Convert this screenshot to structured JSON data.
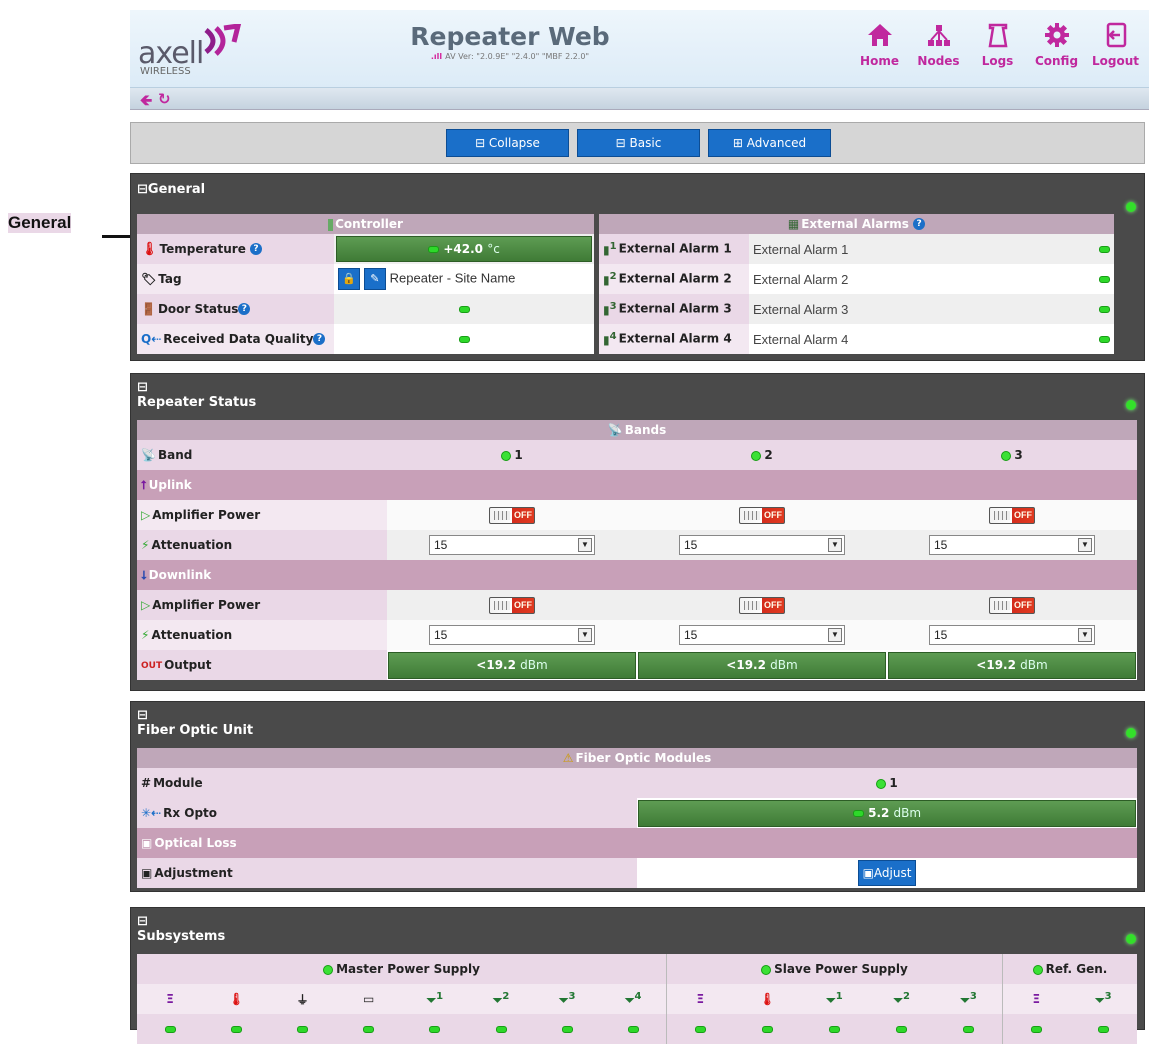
{
  "callout": {
    "label": "General"
  },
  "header": {
    "logo_text": "axell",
    "logo_sub": "WIRELESS",
    "title": "Repeater Web",
    "version": "AV Ver: \"2.0.9E\" \"2.4.0\" \"MBF 2.2.0\"",
    "nav": [
      {
        "label": "Home",
        "icon": "home-icon"
      },
      {
        "label": "Nodes",
        "icon": "nodes-icon"
      },
      {
        "label": "Logs",
        "icon": "logs-icon"
      },
      {
        "label": "Config",
        "icon": "gear-icon"
      },
      {
        "label": "Logout",
        "icon": "logout-icon"
      }
    ]
  },
  "toolbar": {
    "back_icon": "back-arrow-icon",
    "refresh_icon": "refresh-icon"
  },
  "buttons": {
    "collapse": "⊟ Collapse",
    "basic": "⊟ Basic",
    "advanced": "⊞ Advanced"
  },
  "general": {
    "title": "⊟General",
    "controller_header": "Controller",
    "rows": [
      {
        "label": "Temperature",
        "value": "+42.0",
        "unit": "°c"
      },
      {
        "label": "Tag",
        "value": "Repeater - Site Name"
      },
      {
        "label": "Door Status"
      },
      {
        "label": "Received Data Quality"
      }
    ],
    "alarms_header": "External Alarms",
    "alarms": [
      {
        "label": "External Alarm 1",
        "sup": "1",
        "value": "External Alarm 1"
      },
      {
        "label": "External Alarm 2",
        "sup": "2",
        "value": "External Alarm 2"
      },
      {
        "label": "External Alarm 3",
        "sup": "3",
        "value": "External Alarm 3"
      },
      {
        "label": "External Alarm 4",
        "sup": "4",
        "value": "External Alarm 4"
      }
    ]
  },
  "repeater": {
    "collapse_glyph": "⊟",
    "title": "Repeater Status",
    "bands_header": "Bands",
    "band_label": "Band",
    "bands": [
      "1",
      "2",
      "3"
    ],
    "uplink": "Uplink",
    "downlink": "Downlink",
    "amp_label": "Amplifier Power",
    "att_label": "Attenuation",
    "toggle_text": "OFF",
    "ul_att": [
      "15",
      "15",
      "15"
    ],
    "dl_att": [
      "15",
      "15",
      "15"
    ],
    "output_label": "Output",
    "outputs": [
      {
        "value": "<19.2",
        "unit": "dBm"
      },
      {
        "value": "<19.2",
        "unit": "dBm"
      },
      {
        "value": "<19.2",
        "unit": "dBm"
      }
    ]
  },
  "fiber": {
    "collapse_glyph": "⊟",
    "title": "Fiber Optic Unit",
    "modules_header": "Fiber Optic Modules",
    "module_label": "Module",
    "module_value": "1",
    "rx_label": "Rx Opto",
    "rx_value": "5.2",
    "rx_unit": "dBm",
    "loss_label": "Optical Loss",
    "adj_label": "Adjustment",
    "adj_button": "Adjust"
  },
  "subsystems": {
    "collapse_glyph": "⊟",
    "title": "Subsystems",
    "master": "Master Power Supply",
    "slave": "Slave Power Supply",
    "ref": "Ref. Gen.",
    "sup_labels": [
      "1",
      "2",
      "3",
      "4"
    ]
  }
}
